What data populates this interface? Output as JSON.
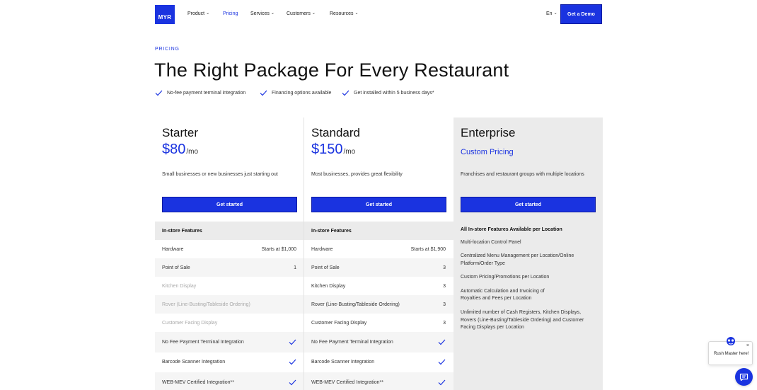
{
  "nav": {
    "logo": "MYR",
    "items": [
      {
        "label": "Product",
        "has_dropdown": true,
        "active": false
      },
      {
        "label": "Pricing",
        "has_dropdown": false,
        "active": true
      },
      {
        "label": "Services",
        "has_dropdown": true,
        "active": false
      },
      {
        "label": "Customers",
        "has_dropdown": true,
        "active": false
      },
      {
        "label": "Resources",
        "has_dropdown": true,
        "active": false
      }
    ],
    "language": "En",
    "cta": "Get a Demo"
  },
  "hero": {
    "eyebrow": "PRICING",
    "title": "The Right Package For Every Restaurant",
    "bullets": [
      "No-fee payment terminal integration",
      "Financing options available",
      "Get installed within 5 business days*"
    ]
  },
  "plans": [
    {
      "name": "Starter",
      "price": "$80",
      "per": "/mo",
      "description": "Small businesses or new businesses just starting out",
      "button": "Get started",
      "features_heading": "In-store Features",
      "features": [
        {
          "label": "Hardware",
          "value": "Starts at $1,000",
          "muted": false
        },
        {
          "label": "Point of Sale",
          "value": "1",
          "muted": false
        },
        {
          "label": "Kitchen Display",
          "value": "",
          "muted": true
        },
        {
          "label": "Rover (Line-Busting/Tableside Ordering)",
          "value": "",
          "muted": true
        },
        {
          "label": "Customer Facing Display",
          "value": "",
          "muted": true
        },
        {
          "label": "No Fee Payment Terminal Integration",
          "check": true
        },
        {
          "label": "Barcode Scanner Integration",
          "check": true
        },
        {
          "label": "WEB-MEV Certified Integration**",
          "check": true
        }
      ]
    },
    {
      "name": "Standard",
      "price": "$150",
      "per": "/mo",
      "description": "Most businesses, provides great flexibility",
      "button": "Get started",
      "features_heading": "In-store Features",
      "features": [
        {
          "label": "Hardware",
          "value": "Starts at $1,900",
          "muted": false
        },
        {
          "label": "Point of Sale",
          "value": "3",
          "muted": false
        },
        {
          "label": "Kitchen Display",
          "value": "3",
          "muted": false
        },
        {
          "label": "Rover (Line-Busting/Tableside Ordering)",
          "value": "3",
          "muted": false
        },
        {
          "label": "Customer Facing Display",
          "value": "3",
          "muted": false
        },
        {
          "label": "No Fee Payment Terminal Integration",
          "check": true
        },
        {
          "label": "Barcode Scanner Integration",
          "check": true
        },
        {
          "label": "WEB-MEV Certified Integration**",
          "check": true
        }
      ]
    }
  ],
  "enterprise": {
    "name": "Enterprise",
    "price": "Custom Pricing",
    "description": "Franchises and restaurant groups with multiple locations",
    "button": "Get started",
    "features_heading": "All In-store Features Available per Location",
    "features": [
      "Multi-location Control Panel",
      "Centralized Menu Management per Location/Online Platform/Order Type",
      "Custom Pricing/Promotions per Location",
      "Automatic Calculation and Invoicing of Royalties and Fees per Location",
      "Unlimited number of Cash Registers, Kitchen Displays, Rovers (Line-Busting/Tableside Ordering) and Customer Facing Displays per Location"
    ]
  },
  "chat": {
    "message": "Rush Master here!",
    "close": "×"
  },
  "colors": {
    "accent": "#1a33e0",
    "panel": "#ebebeb",
    "muted_text": "#a8a8a8"
  }
}
